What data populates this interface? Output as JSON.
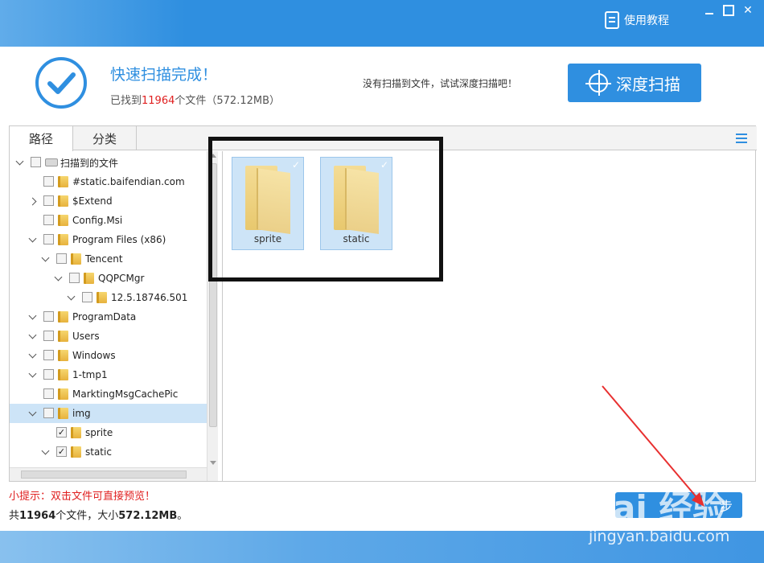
{
  "titlebar": {
    "tutorial_label": "使用教程"
  },
  "header": {
    "title": "快速扫描完成！",
    "found_prefix": "已找到",
    "found_count": "11964",
    "found_suffix": "个文件（572.12MB）",
    "deep_hint": "没有扫描到文件，试试深度扫描吧！",
    "deep_button": "深度扫描"
  },
  "tabs": [
    {
      "label": "路径"
    },
    {
      "label": "分类"
    }
  ],
  "tree": [
    {
      "label": "扫描到的文件",
      "depth": 0,
      "expander": "down",
      "checked": false,
      "icon": "drive",
      "selected": false
    },
    {
      "label": "#static.baifendian.com",
      "depth": 1,
      "expander": "none",
      "checked": false,
      "icon": "folder",
      "selected": false
    },
    {
      "label": "$Extend",
      "depth": 1,
      "expander": "right",
      "checked": false,
      "icon": "folder",
      "selected": false
    },
    {
      "label": "Config.Msi",
      "depth": 1,
      "expander": "none",
      "checked": false,
      "icon": "folder",
      "selected": false
    },
    {
      "label": "Program Files (x86)",
      "depth": 1,
      "expander": "down",
      "checked": false,
      "icon": "folder",
      "selected": false
    },
    {
      "label": "Tencent",
      "depth": 2,
      "expander": "down",
      "checked": false,
      "icon": "folder",
      "selected": false
    },
    {
      "label": "QQPCMgr",
      "depth": 3,
      "expander": "down",
      "checked": false,
      "icon": "folder",
      "selected": false
    },
    {
      "label": "12.5.18746.501",
      "depth": 4,
      "expander": "down",
      "checked": false,
      "icon": "folder",
      "selected": false
    },
    {
      "label": "ProgramData",
      "depth": 1,
      "expander": "down",
      "checked": false,
      "icon": "folder",
      "selected": false
    },
    {
      "label": "Users",
      "depth": 1,
      "expander": "down",
      "checked": false,
      "icon": "folder",
      "selected": false
    },
    {
      "label": "Windows",
      "depth": 1,
      "expander": "down",
      "checked": false,
      "icon": "folder",
      "selected": false
    },
    {
      "label": "1-tmp1",
      "depth": 1,
      "expander": "down",
      "checked": false,
      "icon": "folder",
      "selected": false
    },
    {
      "label": "MarktingMsgCachePic",
      "depth": 1,
      "expander": "none",
      "checked": false,
      "icon": "folder",
      "selected": false
    },
    {
      "label": "img",
      "depth": 1,
      "expander": "down",
      "checked": false,
      "icon": "folder",
      "selected": true
    },
    {
      "label": "sprite",
      "depth": 2,
      "expander": "none",
      "checked": true,
      "icon": "folder",
      "selected": false
    },
    {
      "label": "static",
      "depth": 2,
      "expander": "down",
      "checked": true,
      "icon": "folder",
      "selected": false
    }
  ],
  "files": [
    {
      "name": "sprite"
    },
    {
      "name": "static"
    }
  ],
  "footer": {
    "tip": "小提示：双击文件可直接预览！",
    "summary_prefix": "共",
    "summary_count": "11964",
    "summary_mid": "个文件，大小",
    "summary_size": "572.12MB",
    "summary_suffix": "。",
    "next_button": "步"
  },
  "watermark": {
    "brand": "Bai 经验",
    "url": "jingyan.baidu.com"
  },
  "colors": {
    "accent": "#2f8fe0",
    "alert": "#e02020",
    "selection": "#cde4f7"
  }
}
